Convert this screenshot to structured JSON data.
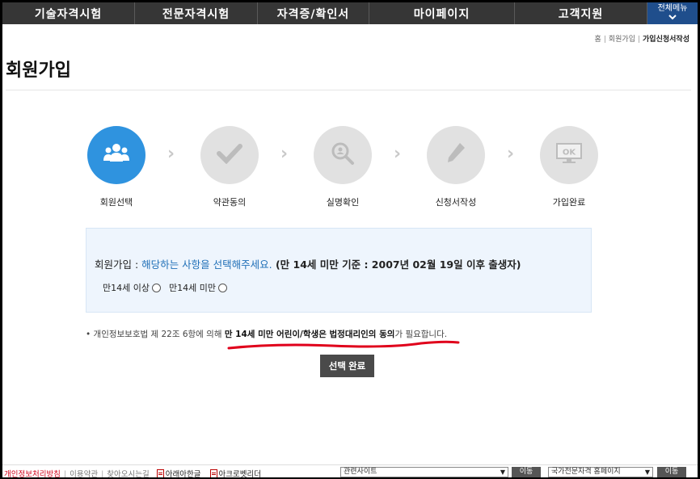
{
  "nav": {
    "items": [
      "기술자격시험",
      "전문자격시험",
      "자격증/확인서",
      "마이페이지",
      "고객지원"
    ],
    "all_menu": "전체메뉴"
  },
  "breadcrumb": {
    "home": "홈",
    "parent": "회원가입",
    "current": "가입신청서작성"
  },
  "page_title": "회원가입",
  "steps": [
    {
      "label": "회원선택",
      "icon": "users-icon",
      "active": true
    },
    {
      "label": "약관동의",
      "icon": "check-icon",
      "active": false
    },
    {
      "label": "실명확인",
      "icon": "search-person-icon",
      "active": false
    },
    {
      "label": "신청서작성",
      "icon": "pencil-icon",
      "active": false
    },
    {
      "label": "가입완료",
      "icon": "ok-monitor-icon",
      "active": false
    }
  ],
  "ok_text": "OK",
  "selection": {
    "prefix": "회원가입 : ",
    "highlight": "해당하는 사항을 선택해주세요.",
    "criteria": " (만 14세 미만 기준 : 2007년 02월 19일 이후 출생자)",
    "options": [
      "만14세 이상",
      "만14세 미만"
    ]
  },
  "notice": {
    "pre": "• 개인정보보호법 제 22조 6항에 의해 ",
    "bold": "만 14세 미만 어린이/학생은 법정대리인의 동의",
    "post": "가 필요합니다."
  },
  "submit_label": "선택 완료",
  "footer": {
    "privacy": "개인정보처리방침",
    "terms": "이용약관",
    "directions": "찾아오시는길",
    "hwp": "아래아한글",
    "acrobat": "아크로벳리더",
    "related_select": "관련사이트",
    "go1": "이동",
    "national_select": "국가전문자격 홈페이지",
    "go2": "이동"
  },
  "colors": {
    "accent": "#2f93df",
    "nav_bg": "#363636",
    "red_mark": "#e0001b"
  }
}
